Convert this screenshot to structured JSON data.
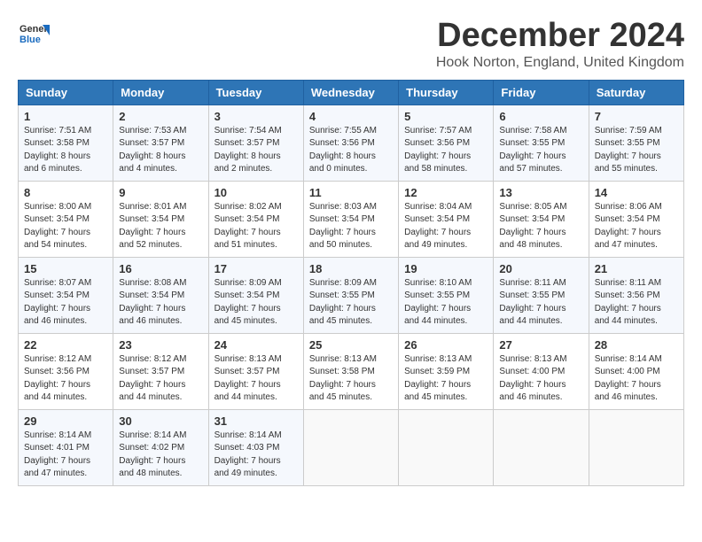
{
  "logo": {
    "line1": "General",
    "line2": "Blue"
  },
  "title": "December 2024",
  "subtitle": "Hook Norton, England, United Kingdom",
  "headers": [
    "Sunday",
    "Monday",
    "Tuesday",
    "Wednesday",
    "Thursday",
    "Friday",
    "Saturday"
  ],
  "weeks": [
    [
      {
        "day": "1",
        "sunrise": "Sunrise: 7:51 AM",
        "sunset": "Sunset: 3:58 PM",
        "daylight": "Daylight: 8 hours and 6 minutes."
      },
      {
        "day": "2",
        "sunrise": "Sunrise: 7:53 AM",
        "sunset": "Sunset: 3:57 PM",
        "daylight": "Daylight: 8 hours and 4 minutes."
      },
      {
        "day": "3",
        "sunrise": "Sunrise: 7:54 AM",
        "sunset": "Sunset: 3:57 PM",
        "daylight": "Daylight: 8 hours and 2 minutes."
      },
      {
        "day": "4",
        "sunrise": "Sunrise: 7:55 AM",
        "sunset": "Sunset: 3:56 PM",
        "daylight": "Daylight: 8 hours and 0 minutes."
      },
      {
        "day": "5",
        "sunrise": "Sunrise: 7:57 AM",
        "sunset": "Sunset: 3:56 PM",
        "daylight": "Daylight: 7 hours and 58 minutes."
      },
      {
        "day": "6",
        "sunrise": "Sunrise: 7:58 AM",
        "sunset": "Sunset: 3:55 PM",
        "daylight": "Daylight: 7 hours and 57 minutes."
      },
      {
        "day": "7",
        "sunrise": "Sunrise: 7:59 AM",
        "sunset": "Sunset: 3:55 PM",
        "daylight": "Daylight: 7 hours and 55 minutes."
      }
    ],
    [
      {
        "day": "8",
        "sunrise": "Sunrise: 8:00 AM",
        "sunset": "Sunset: 3:54 PM",
        "daylight": "Daylight: 7 hours and 54 minutes."
      },
      {
        "day": "9",
        "sunrise": "Sunrise: 8:01 AM",
        "sunset": "Sunset: 3:54 PM",
        "daylight": "Daylight: 7 hours and 52 minutes."
      },
      {
        "day": "10",
        "sunrise": "Sunrise: 8:02 AM",
        "sunset": "Sunset: 3:54 PM",
        "daylight": "Daylight: 7 hours and 51 minutes."
      },
      {
        "day": "11",
        "sunrise": "Sunrise: 8:03 AM",
        "sunset": "Sunset: 3:54 PM",
        "daylight": "Daylight: 7 hours and 50 minutes."
      },
      {
        "day": "12",
        "sunrise": "Sunrise: 8:04 AM",
        "sunset": "Sunset: 3:54 PM",
        "daylight": "Daylight: 7 hours and 49 minutes."
      },
      {
        "day": "13",
        "sunrise": "Sunrise: 8:05 AM",
        "sunset": "Sunset: 3:54 PM",
        "daylight": "Daylight: 7 hours and 48 minutes."
      },
      {
        "day": "14",
        "sunrise": "Sunrise: 8:06 AM",
        "sunset": "Sunset: 3:54 PM",
        "daylight": "Daylight: 7 hours and 47 minutes."
      }
    ],
    [
      {
        "day": "15",
        "sunrise": "Sunrise: 8:07 AM",
        "sunset": "Sunset: 3:54 PM",
        "daylight": "Daylight: 7 hours and 46 minutes."
      },
      {
        "day": "16",
        "sunrise": "Sunrise: 8:08 AM",
        "sunset": "Sunset: 3:54 PM",
        "daylight": "Daylight: 7 hours and 46 minutes."
      },
      {
        "day": "17",
        "sunrise": "Sunrise: 8:09 AM",
        "sunset": "Sunset: 3:54 PM",
        "daylight": "Daylight: 7 hours and 45 minutes."
      },
      {
        "day": "18",
        "sunrise": "Sunrise: 8:09 AM",
        "sunset": "Sunset: 3:55 PM",
        "daylight": "Daylight: 7 hours and 45 minutes."
      },
      {
        "day": "19",
        "sunrise": "Sunrise: 8:10 AM",
        "sunset": "Sunset: 3:55 PM",
        "daylight": "Daylight: 7 hours and 44 minutes."
      },
      {
        "day": "20",
        "sunrise": "Sunrise: 8:11 AM",
        "sunset": "Sunset: 3:55 PM",
        "daylight": "Daylight: 7 hours and 44 minutes."
      },
      {
        "day": "21",
        "sunrise": "Sunrise: 8:11 AM",
        "sunset": "Sunset: 3:56 PM",
        "daylight": "Daylight: 7 hours and 44 minutes."
      }
    ],
    [
      {
        "day": "22",
        "sunrise": "Sunrise: 8:12 AM",
        "sunset": "Sunset: 3:56 PM",
        "daylight": "Daylight: 7 hours and 44 minutes."
      },
      {
        "day": "23",
        "sunrise": "Sunrise: 8:12 AM",
        "sunset": "Sunset: 3:57 PM",
        "daylight": "Daylight: 7 hours and 44 minutes."
      },
      {
        "day": "24",
        "sunrise": "Sunrise: 8:13 AM",
        "sunset": "Sunset: 3:57 PM",
        "daylight": "Daylight: 7 hours and 44 minutes."
      },
      {
        "day": "25",
        "sunrise": "Sunrise: 8:13 AM",
        "sunset": "Sunset: 3:58 PM",
        "daylight": "Daylight: 7 hours and 45 minutes."
      },
      {
        "day": "26",
        "sunrise": "Sunrise: 8:13 AM",
        "sunset": "Sunset: 3:59 PM",
        "daylight": "Daylight: 7 hours and 45 minutes."
      },
      {
        "day": "27",
        "sunrise": "Sunrise: 8:13 AM",
        "sunset": "Sunset: 4:00 PM",
        "daylight": "Daylight: 7 hours and 46 minutes."
      },
      {
        "day": "28",
        "sunrise": "Sunrise: 8:14 AM",
        "sunset": "Sunset: 4:00 PM",
        "daylight": "Daylight: 7 hours and 46 minutes."
      }
    ],
    [
      {
        "day": "29",
        "sunrise": "Sunrise: 8:14 AM",
        "sunset": "Sunset: 4:01 PM",
        "daylight": "Daylight: 7 hours and 47 minutes."
      },
      {
        "day": "30",
        "sunrise": "Sunrise: 8:14 AM",
        "sunset": "Sunset: 4:02 PM",
        "daylight": "Daylight: 7 hours and 48 minutes."
      },
      {
        "day": "31",
        "sunrise": "Sunrise: 8:14 AM",
        "sunset": "Sunset: 4:03 PM",
        "daylight": "Daylight: 7 hours and 49 minutes."
      },
      null,
      null,
      null,
      null
    ]
  ]
}
